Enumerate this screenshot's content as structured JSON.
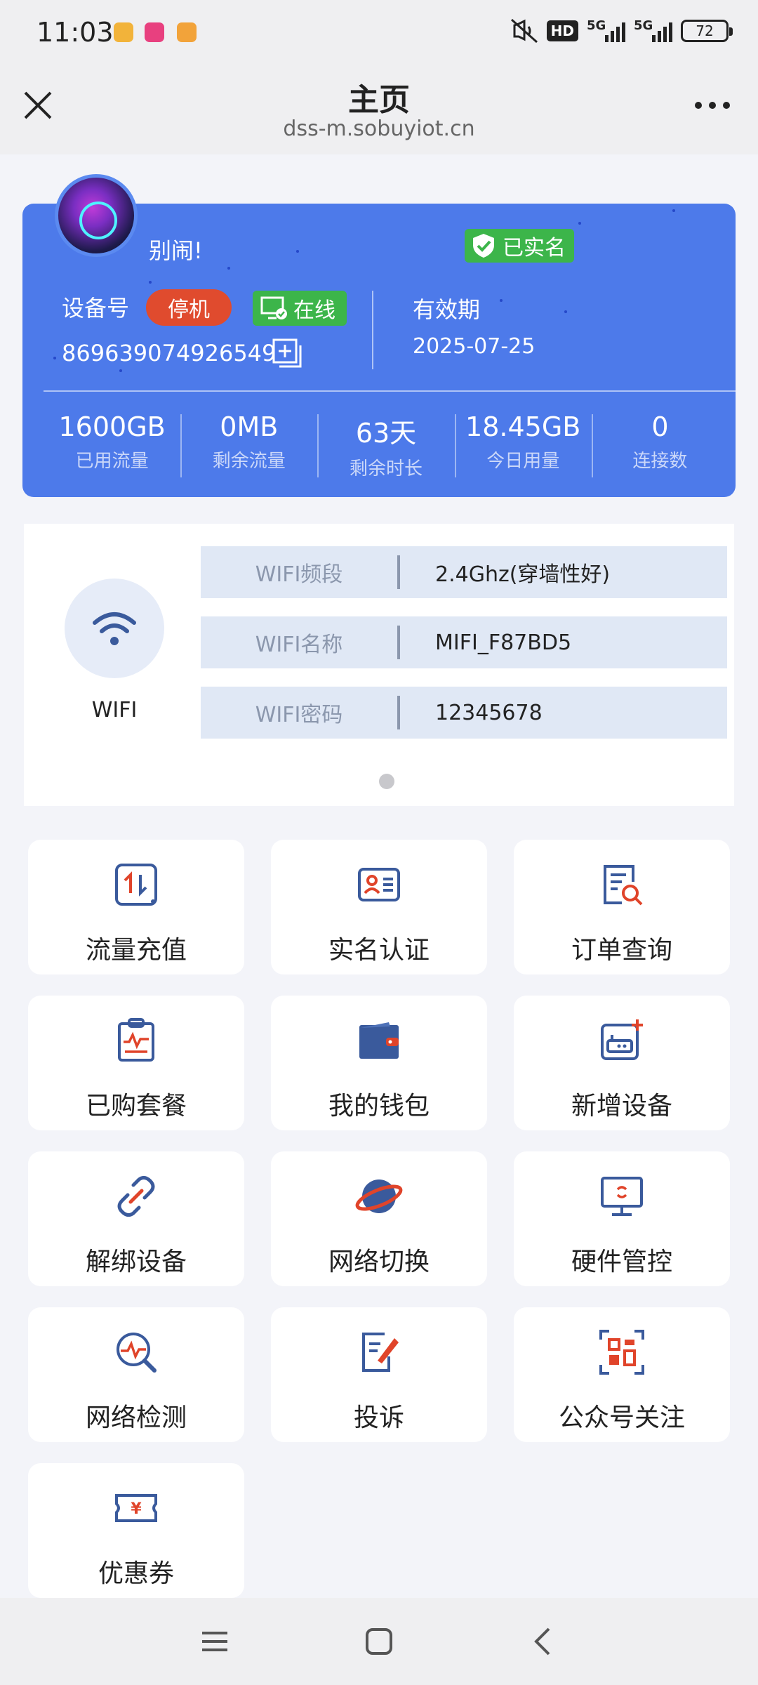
{
  "status_bar": {
    "time": "11:03",
    "app_icons": [
      "chat-app-icon",
      "shop-app-icon",
      "game-app-icon"
    ],
    "hd_badge": "HD",
    "signal_1": "5G",
    "signal_2": "5G",
    "battery": "72"
  },
  "header": {
    "title": "主页",
    "url": "dss-m.sobuyiot.cn"
  },
  "device": {
    "nickname": "别闹!",
    "verified": "已实名",
    "number_label": "设备号",
    "status_stop": "停机",
    "status_online": "在线",
    "number": "869639074926549",
    "validity_label": "有效期",
    "validity_date": "2025-07-25",
    "stats": [
      {
        "value": "1600GB",
        "label": "已用流量"
      },
      {
        "value": "0MB",
        "label": "剩余流量"
      },
      {
        "value": "63天",
        "label": "剩余时长"
      },
      {
        "value": "18.45GB",
        "label": "今日用量"
      },
      {
        "value": "0",
        "label": "连接数"
      }
    ]
  },
  "wifi": {
    "caption": "WIFI",
    "rows": [
      {
        "key": "WIFI频段",
        "value": "2.4Ghz(穿墙性好)"
      },
      {
        "key": "WIFI名称",
        "value": "MIFI_F87BD5"
      },
      {
        "key": "WIFI密码",
        "value": "12345678"
      }
    ]
  },
  "tiles": [
    {
      "label": "流量充值",
      "icon": "data-recharge-icon"
    },
    {
      "label": "实名认证",
      "icon": "id-card-icon"
    },
    {
      "label": "订单查询",
      "icon": "order-search-icon"
    },
    {
      "label": "已购套餐",
      "icon": "clipboard-icon"
    },
    {
      "label": "我的钱包",
      "icon": "wallet-icon"
    },
    {
      "label": "新增设备",
      "icon": "add-device-icon"
    },
    {
      "label": "解绑设备",
      "icon": "unlink-icon"
    },
    {
      "label": "网络切换",
      "icon": "planet-icon"
    },
    {
      "label": "硬件管控",
      "icon": "monitor-icon"
    },
    {
      "label": "网络检测",
      "icon": "network-check-icon"
    },
    {
      "label": "投诉",
      "icon": "complaint-icon"
    },
    {
      "label": "公众号关注",
      "icon": "qr-code-icon"
    },
    {
      "label": "优惠券",
      "icon": "coupon-icon"
    }
  ],
  "colors": {
    "card_blue": "#4d7aea",
    "icon_blue": "#3a5a9c",
    "icon_red": "#e0442a",
    "green": "#3cb54a",
    "stop_red": "#e04b2e"
  }
}
